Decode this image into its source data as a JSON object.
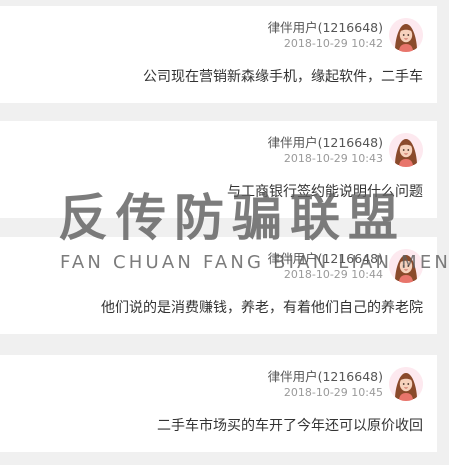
{
  "messages": [
    {
      "user": "律伴用户(1216648)",
      "time": "2018-10-29 10:42",
      "text": "公司现在营销新森缘手机，缘起软件，二手车"
    },
    {
      "user": "律伴用户(1216648)",
      "time": "2018-10-29 10:43",
      "text": "与工商银行签约能说明什么问题"
    },
    {
      "user": "律伴用户(1216648)",
      "time": "2018-10-29 10:44",
      "text": "他们说的是消费赚钱，养老，有着他们自己的养老院"
    },
    {
      "user": "律伴用户(1216648)",
      "time": "2018-10-29 10:45",
      "text": "二手车市场买的车开了今年还可以原价收回"
    }
  ],
  "watermark": {
    "chinese": "反传防骗联盟",
    "pinyin": "FAN CHUAN FANG BIAN LIAN MENG"
  },
  "colors": {
    "background": "#f0f0f0",
    "card": "#ffffff",
    "username": "#555555",
    "timestamp": "#9a9a9a",
    "message_text": "#333333"
  },
  "icons": {
    "avatar": "avatar-female-icon"
  }
}
